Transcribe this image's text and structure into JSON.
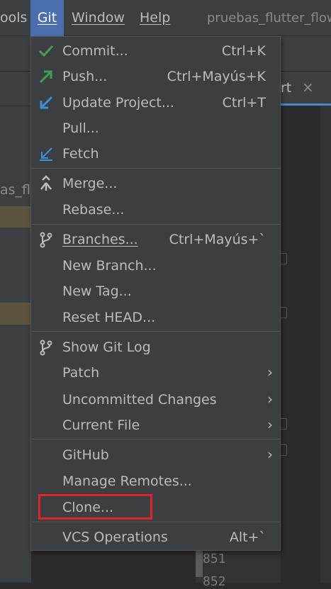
{
  "menubar": {
    "tools": "ools",
    "git": "Git",
    "window": "Window",
    "help": "Help",
    "project_title": "pruebas_flutter_flow"
  },
  "left_panel": {
    "project_label": "as_flu"
  },
  "editor": {
    "tab_label": "rt",
    "tab_close": "×",
    "line_numbers": [
      "851",
      "852"
    ]
  },
  "git_menu": {
    "commit": {
      "label": "Commit...",
      "shortcut": "Ctrl+K",
      "icon": "check-icon",
      "color": "#4e9a4e"
    },
    "push": {
      "label": "Push...",
      "shortcut": "Ctrl+Mayús+K",
      "icon": "push-arrow-icon",
      "color": "#3fa05a"
    },
    "update_project": {
      "label": "Update Project...",
      "shortcut": "Ctrl+T",
      "icon": "update-arrow-icon",
      "color": "#3f8fd6"
    },
    "pull": {
      "label": "Pull..."
    },
    "fetch": {
      "label": "Fetch",
      "icon": "fetch-icon",
      "color": "#3f8fd6"
    },
    "merge": {
      "label": "Merge...",
      "icon": "merge-icon"
    },
    "rebase": {
      "label": "Rebase..."
    },
    "branches": {
      "label": "Branches...",
      "shortcut": "Ctrl+Mayús+`",
      "icon": "branch-icon"
    },
    "new_branch": {
      "label": "New Branch..."
    },
    "new_tag": {
      "label": "New Tag..."
    },
    "reset_head": {
      "label": "Reset HEAD..."
    },
    "show_git_log": {
      "label": "Show Git Log",
      "icon": "git-log-icon"
    },
    "patch": {
      "label": "Patch"
    },
    "uncommitted_changes": {
      "label": "Uncommitted Changes"
    },
    "current_file": {
      "label": "Current File"
    },
    "github": {
      "label": "GitHub"
    },
    "manage_remotes": {
      "label": "Manage Remotes..."
    },
    "clone": {
      "label": "Clone..."
    },
    "vcs_operations": {
      "label": "VCS Operations",
      "shortcut": "Alt+`"
    }
  },
  "colors": {
    "menu_bg": "#3c3f41",
    "active_menu_bg": "#4b6eaf",
    "highlight_border": "#e0222a"
  }
}
